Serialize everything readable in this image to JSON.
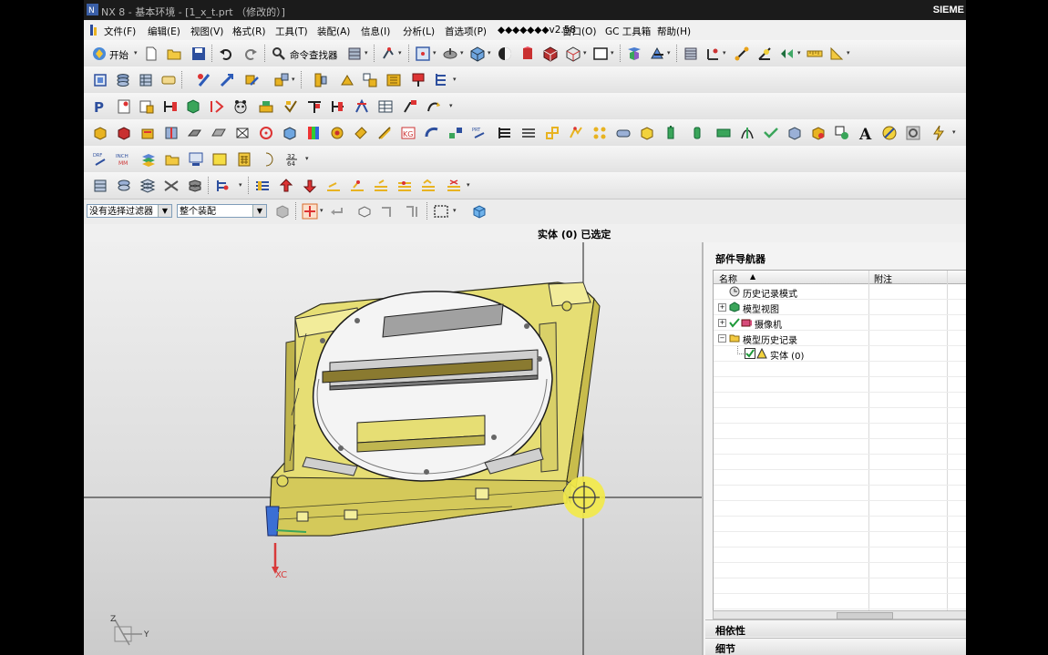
{
  "window": {
    "title": "NX 8 - 基本环境 - [1_x_t.prt （修改的）]",
    "brand": "SIEME"
  },
  "menu": [
    {
      "label": "文件(F)",
      "name": "menu-file"
    },
    {
      "label": "编辑(E)",
      "name": "menu-edit"
    },
    {
      "label": "视图(V)",
      "name": "menu-view"
    },
    {
      "label": "格式(R)",
      "name": "menu-format"
    },
    {
      "label": "工具(T)",
      "name": "menu-tools"
    },
    {
      "label": "装配(A)",
      "name": "menu-assembly"
    },
    {
      "label": "信息(I)",
      "name": "menu-info"
    },
    {
      "label": "分析(L)",
      "name": "menu-analysis"
    },
    {
      "label": "首选项(P)",
      "name": "menu-preferences"
    },
    {
      "label": "◆◆◆◆◆◆◆v2.58",
      "name": "menu-plugin"
    },
    {
      "label": "窗口(O)",
      "name": "menu-window"
    },
    {
      "label": "GC 工具箱",
      "name": "menu-gc-toolbox"
    },
    {
      "label": "帮助(H)",
      "name": "menu-help"
    }
  ],
  "toolbar": {
    "start_label": "开始",
    "command_finder_label": "命令查找器"
  },
  "filter": {
    "selection_filter": "没有选择过滤器",
    "scope": "整个装配"
  },
  "status": {
    "text": "实体 (0) 已选定"
  },
  "viewport": {
    "wcs_label": "XC",
    "triad_z": "Z",
    "triad_y": "Y"
  },
  "navigator": {
    "title": "部件导航器",
    "columns": {
      "name": "名称",
      "note": "附注"
    },
    "items": [
      {
        "label": "历史记录模式",
        "icon": "clock-icon"
      },
      {
        "label": "模型视图",
        "icon": "model-views-icon"
      },
      {
        "label": "摄像机",
        "icon": "camera-icon"
      },
      {
        "label": "模型历史记录",
        "icon": "folder-open-icon"
      },
      {
        "label": "实体 (0)",
        "icon": "solid-body-icon"
      }
    ],
    "dependencies_label": "相依性",
    "details_label": "细节"
  },
  "colors": {
    "accent_yellow": "#f2e94a",
    "part_yellow": "#e8e07a",
    "title_bg": "#1b1b1b",
    "viewport_bg": "#dedede"
  }
}
